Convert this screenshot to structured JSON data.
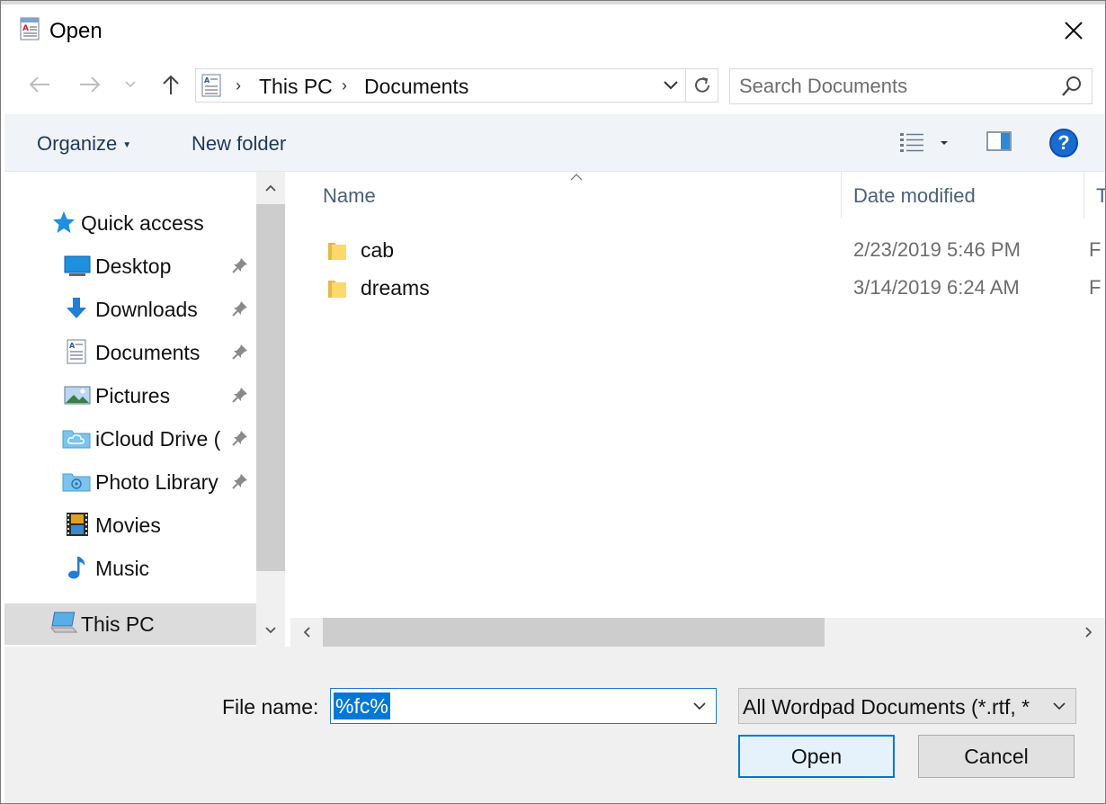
{
  "window": {
    "title": "Open"
  },
  "address": {
    "crumbs": [
      "This PC",
      "Documents"
    ],
    "search_placeholder": "Search Documents"
  },
  "commands": {
    "organize": "Organize",
    "new_folder": "New folder"
  },
  "nav": {
    "items": [
      {
        "label": "Quick access",
        "icon": "star-icon",
        "pinned": false
      },
      {
        "label": "Desktop",
        "icon": "desktop-icon",
        "pinned": true
      },
      {
        "label": "Downloads",
        "icon": "download-arrow-icon",
        "pinned": true
      },
      {
        "label": "Documents",
        "icon": "document-icon",
        "pinned": true
      },
      {
        "label": "Pictures",
        "icon": "pictures-icon",
        "pinned": true
      },
      {
        "label": "iCloud Drive (",
        "icon": "icloud-folder-icon",
        "pinned": true
      },
      {
        "label": "Photo Library",
        "icon": "photo-library-folder-icon",
        "pinned": true
      },
      {
        "label": "Movies",
        "icon": "film-strip-icon",
        "pinned": false
      },
      {
        "label": "Music",
        "icon": "music-note-icon",
        "pinned": false
      },
      {
        "label": "This PC",
        "icon": "computer-icon",
        "pinned": false,
        "selected": true
      }
    ]
  },
  "files": {
    "columns": {
      "name": "Name",
      "date": "Date modified",
      "type": "T"
    },
    "rows": [
      {
        "name": "cab",
        "date": "2/23/2019 5:46 PM",
        "type": "F"
      },
      {
        "name": "dreams",
        "date": "3/14/2019 6:24 AM",
        "type": "F"
      }
    ]
  },
  "bottom": {
    "file_name_label": "File name:",
    "file_name_value": "%fc%",
    "file_type": "All Wordpad Documents (*.rtf, *",
    "open_label": "Open",
    "cancel_label": "Cancel"
  },
  "colors": {
    "accent": "#0078d7",
    "command_text": "#1e395b",
    "header_text": "#4c607a",
    "help": "#1a6bd0"
  }
}
